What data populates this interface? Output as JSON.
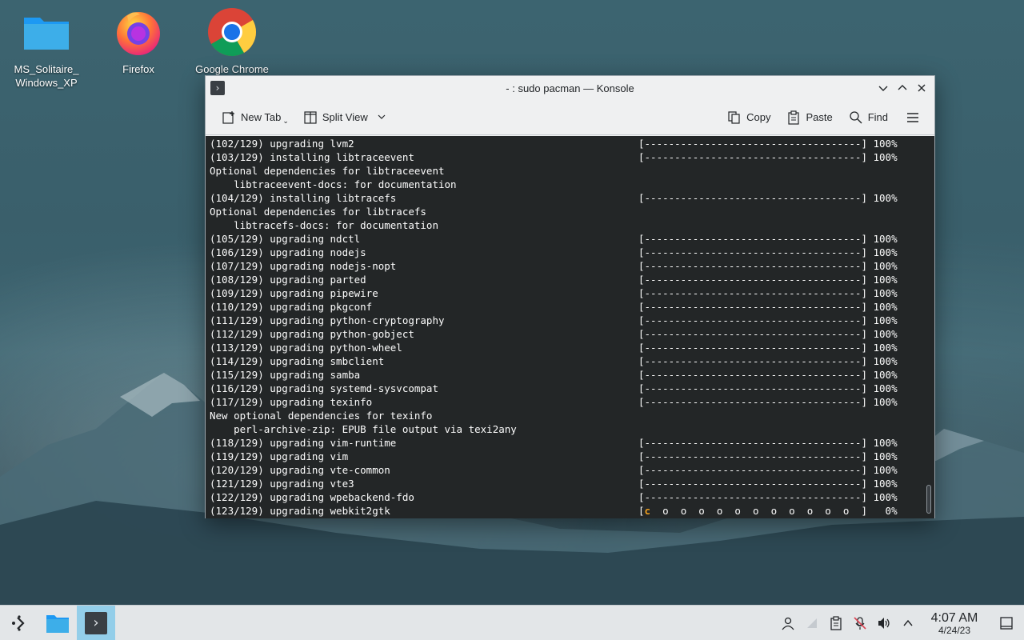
{
  "desktop": {
    "icons": [
      {
        "label_line1": "MS_Solitaire_",
        "label_line2": "Windows_XP",
        "icon": "folder-icon"
      },
      {
        "label_line1": "Firefox",
        "label_line2": "",
        "icon": "firefox-icon"
      },
      {
        "label_line1": "Google Chrome",
        "label_line2": "",
        "icon": "chrome-icon"
      }
    ]
  },
  "window": {
    "title": "- : sudo pacman — Konsole",
    "controls": [
      "minimize",
      "maximize",
      "close"
    ]
  },
  "toolbar": {
    "new_tab": "New Tab",
    "split_view": "Split View",
    "copy": "Copy",
    "paste": "Paste",
    "find": "Find"
  },
  "terminal": {
    "lines": [
      {
        "text": "(102/129) upgrading lvm2",
        "progress": "[------------------------------------] 100%"
      },
      {
        "text": "(103/129) installing libtraceevent",
        "progress": "[------------------------------------] 100%"
      },
      {
        "text": "Optional dependencies for libtraceevent",
        "progress": ""
      },
      {
        "text": "    libtraceevent-docs: for documentation",
        "progress": ""
      },
      {
        "text": "(104/129) installing libtracefs",
        "progress": "[------------------------------------] 100%"
      },
      {
        "text": "Optional dependencies for libtracefs",
        "progress": ""
      },
      {
        "text": "    libtracefs-docs: for documentation",
        "progress": ""
      },
      {
        "text": "(105/129) upgrading ndctl",
        "progress": "[------------------------------------] 100%"
      },
      {
        "text": "(106/129) upgrading nodejs",
        "progress": "[------------------------------------] 100%"
      },
      {
        "text": "(107/129) upgrading nodejs-nopt",
        "progress": "[------------------------------------] 100%"
      },
      {
        "text": "(108/129) upgrading parted",
        "progress": "[------------------------------------] 100%"
      },
      {
        "text": "(109/129) upgrading pipewire",
        "progress": "[------------------------------------] 100%"
      },
      {
        "text": "(110/129) upgrading pkgconf",
        "progress": "[------------------------------------] 100%"
      },
      {
        "text": "(111/129) upgrading python-cryptography",
        "progress": "[------------------------------------] 100%"
      },
      {
        "text": "(112/129) upgrading python-gobject",
        "progress": "[------------------------------------] 100%"
      },
      {
        "text": "(113/129) upgrading python-wheel",
        "progress": "[------------------------------------] 100%"
      },
      {
        "text": "(114/129) upgrading smbclient",
        "progress": "[------------------------------------] 100%"
      },
      {
        "text": "(115/129) upgrading samba",
        "progress": "[------------------------------------] 100%"
      },
      {
        "text": "(116/129) upgrading systemd-sysvcompat",
        "progress": "[------------------------------------] 100%"
      },
      {
        "text": "(117/129) upgrading texinfo",
        "progress": "[------------------------------------] 100%"
      },
      {
        "text": "New optional dependencies for texinfo",
        "progress": ""
      },
      {
        "text": "    perl-archive-zip: EPUB file output via texi2any",
        "progress": ""
      },
      {
        "text": "(118/129) upgrading vim-runtime",
        "progress": "[------------------------------------] 100%"
      },
      {
        "text": "(119/129) upgrading vim",
        "progress": "[------------------------------------] 100%"
      },
      {
        "text": "(120/129) upgrading vte-common",
        "progress": "[------------------------------------] 100%"
      },
      {
        "text": "(121/129) upgrading vte3",
        "progress": "[------------------------------------] 100%"
      },
      {
        "text": "(122/129) upgrading wpebackend-fdo",
        "progress": "[------------------------------------] 100%"
      },
      {
        "text": "(123/129) upgrading webkit2gtk",
        "progress": "",
        "active_progress": {
          "open": "[",
          "cursor": "c",
          "rest": "  o  o  o  o  o  o  o  o  o  o  o  ]   0%"
        }
      }
    ]
  },
  "taskbar": {
    "items": [
      "launcher-icon",
      "dolphin-icon",
      "konsole-icon"
    ],
    "active_item": "konsole-icon",
    "tray": [
      "user-icon",
      "network-icon",
      "clipboard-icon",
      "mic-muted-icon",
      "volume-icon",
      "chevron-up-icon"
    ],
    "time": "4:07 AM",
    "date": "4/24/23"
  },
  "colors": {
    "terminal_bg": "#232627",
    "terminal_fg": "#fcfcfc",
    "progress_cursor": "#f0a01e",
    "taskbar_active": "#93cee9"
  }
}
